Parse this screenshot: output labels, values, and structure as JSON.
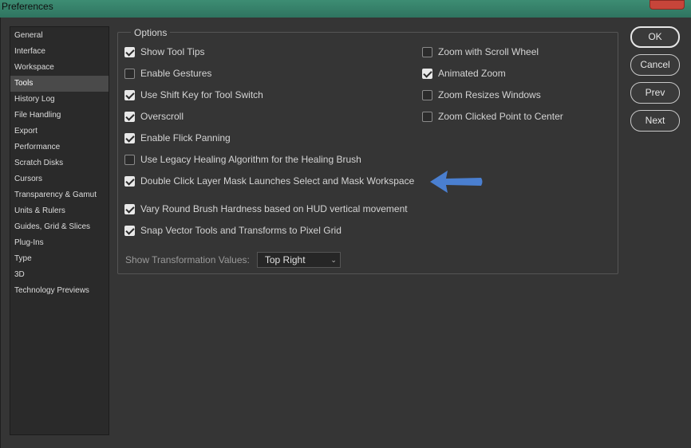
{
  "window": {
    "title": "Preferences"
  },
  "sidebar": {
    "items": [
      "General",
      "Interface",
      "Workspace",
      "Tools",
      "History Log",
      "File Handling",
      "Export",
      "Performance",
      "Scratch Disks",
      "Cursors",
      "Transparency & Gamut",
      "Units & Rulers",
      "Guides, Grid & Slices",
      "Plug-Ins",
      "Type",
      "3D",
      "Technology Previews"
    ],
    "active": "Tools"
  },
  "options": {
    "legend": "Options",
    "left": [
      {
        "label": "Show Tool Tips",
        "checked": true
      },
      {
        "label": "Enable Gestures",
        "checked": false
      },
      {
        "label": "Use Shift Key for Tool Switch",
        "checked": true
      },
      {
        "label": "Overscroll",
        "checked": true
      },
      {
        "label": "Enable Flick Panning",
        "checked": true
      },
      {
        "label": "Use Legacy Healing Algorithm for the Healing Brush",
        "checked": false
      },
      {
        "label": "Double Click Layer Mask Launches Select and Mask Workspace",
        "checked": true
      },
      {
        "label": "Vary Round Brush Hardness based on HUD vertical movement",
        "checked": true
      },
      {
        "label": "Snap Vector Tools and Transforms to Pixel Grid",
        "checked": true
      }
    ],
    "right": [
      {
        "label": "Zoom with Scroll Wheel",
        "checked": false
      },
      {
        "label": "Animated Zoom",
        "checked": true
      },
      {
        "label": "Zoom Resizes Windows",
        "checked": false
      },
      {
        "label": "Zoom Clicked Point to Center",
        "checked": false
      }
    ],
    "transform": {
      "label": "Show Transformation Values:",
      "value": "Top Right"
    }
  },
  "buttons": {
    "ok": "OK",
    "cancel": "Cancel",
    "prev": "Prev",
    "next": "Next"
  },
  "colors": {
    "arrow": "#4a7fd0",
    "panel": "#353535",
    "sidebar": "#2a2a2a"
  },
  "icons": {
    "arrow": "left-arrow-icon",
    "close": "close-icon",
    "dropdown": "chevron-down-icon"
  }
}
